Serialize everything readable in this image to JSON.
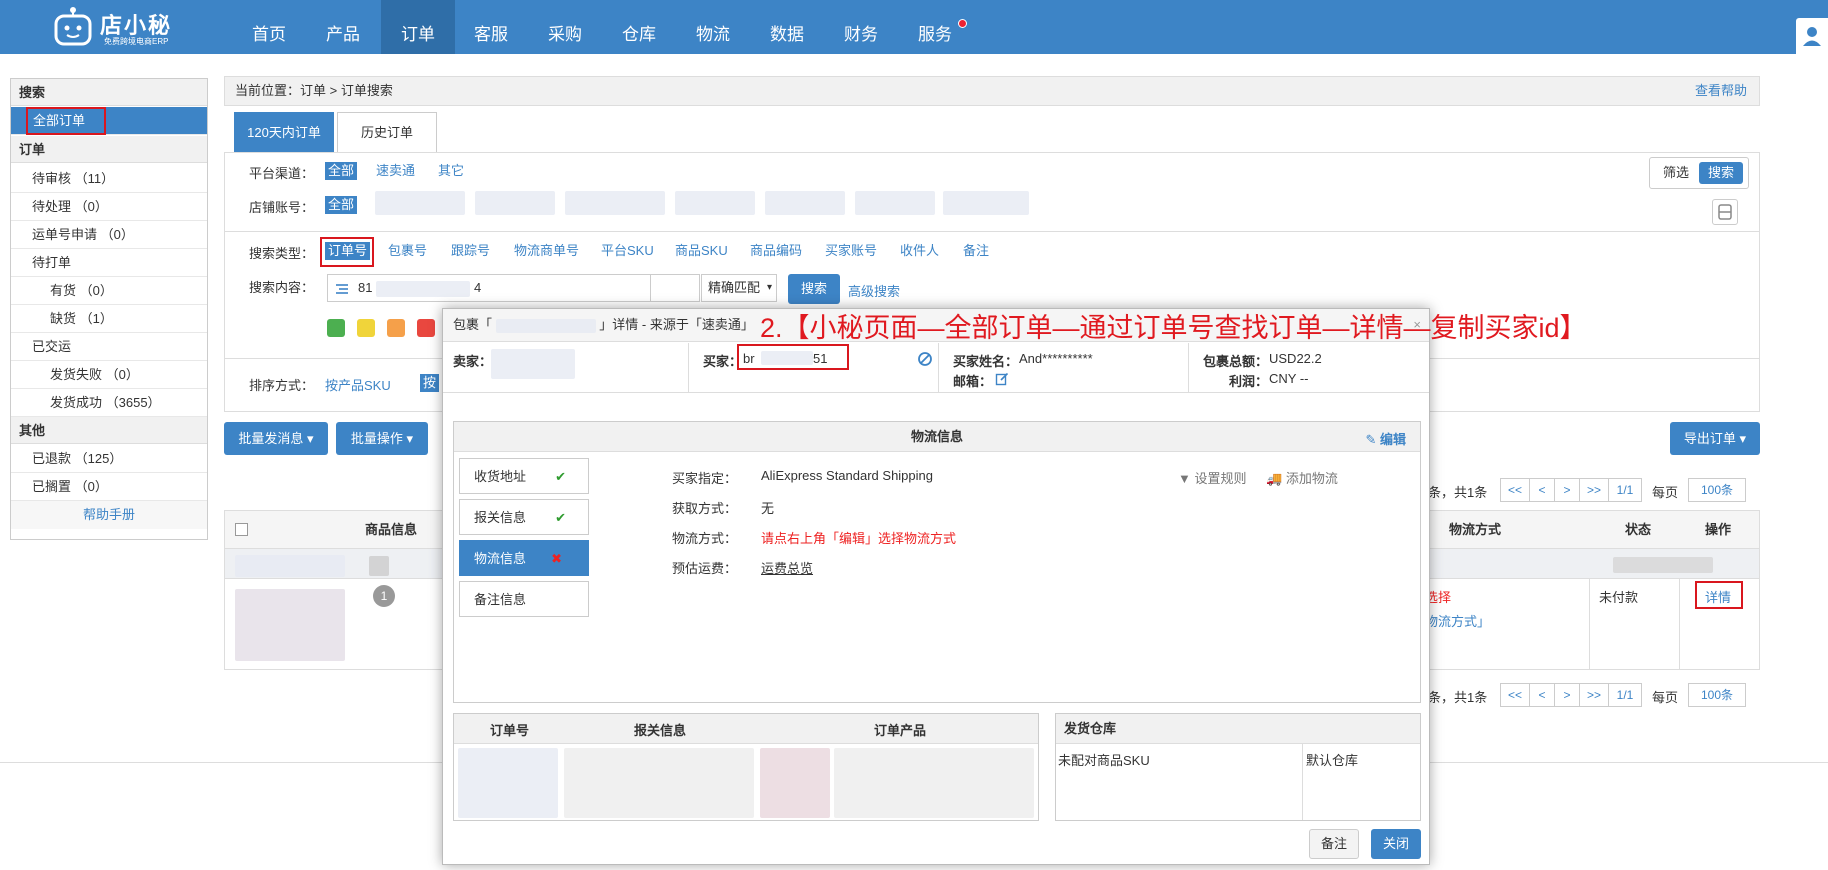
{
  "topnav": {
    "logo_name": "店小秘",
    "logo_sub": "免费跨境电商ERP",
    "items": [
      "首页",
      "产品",
      "订单",
      "客服",
      "采购",
      "仓库",
      "物流",
      "数据",
      "财务",
      "服务"
    ],
    "active": "订单"
  },
  "sidebar": {
    "search_header": "搜索",
    "all_orders": "全部订单",
    "orders_header": "订单",
    "items": [
      {
        "label": "待审核",
        "count": "（11）"
      },
      {
        "label": "待处理",
        "count": "（0）"
      },
      {
        "label": "运单号申请",
        "count": "（0）"
      },
      {
        "label": "待打单",
        "count": ""
      },
      {
        "label": "有货",
        "count": "（0）"
      },
      {
        "label": "缺货",
        "count": "（1）"
      },
      {
        "label": "已交运",
        "count": ""
      },
      {
        "label": "发货失败",
        "count": "（0）"
      },
      {
        "label": "发货成功",
        "count": "（3655）"
      }
    ],
    "other_header": "其他",
    "other_items": [
      {
        "label": "已退款",
        "count": "（125）"
      },
      {
        "label": "已搁置",
        "count": "（0）"
      }
    ],
    "help": "帮助手册"
  },
  "breadcrumb": {
    "text": "当前位置：订单 > 订单搜索",
    "help": "查看帮助"
  },
  "tabs": [
    "120天内订单",
    "历史订单"
  ],
  "filters": {
    "platform_label": "平台渠道：",
    "platform_opts": [
      "全部",
      "速卖通",
      "其它"
    ],
    "shop_label": "店铺账号：",
    "shop_all": "全部",
    "filter_btn": "筛选",
    "search_btn_top": "搜索",
    "search_type_label": "搜索类型：",
    "search_types": [
      "订单号",
      "包裹号",
      "跟踪号",
      "物流商单号",
      "平台SKU",
      "商品SKU",
      "商品编码",
      "买家账号",
      "收件人",
      "备注"
    ],
    "content_label": "搜索内容：",
    "content_value": "81",
    "content_value_tail": "4",
    "match_mode": "精确匹配",
    "search_btn": "搜索",
    "advanced": "高级搜索",
    "sort_label": "排序方式：",
    "sort_opt1": "按产品SKU",
    "sort_opt2": "按"
  },
  "toolbar": {
    "bulk_msg": "批量发消息 ▾",
    "bulk_op": "批量操作 ▾",
    "export": "导出订单 ▾"
  },
  "pager": {
    "summary": "条，共1条",
    "first": "<<",
    "prev": "<",
    "next": ">",
    "last": ">>",
    "page": "1/1",
    "per_label": "每页",
    "per_value": "100条"
  },
  "table": {
    "headers": {
      "product": "商品信息",
      "shipping": "物流方式",
      "status": "状态",
      "action": "操作"
    },
    "row": {
      "badge": "1",
      "ship1": "选择",
      "ship2": "物流方式」",
      "status": "未付款",
      "action": "详情"
    }
  },
  "modal": {
    "title_prefix": "包裹「",
    "title_suffix": "」详情 - 来源于「速卖通」",
    "seller_label": "卖家：",
    "buyer_label": "买家：",
    "buyer_prefix": "br",
    "buyer_suffix": "51",
    "buyer_name_label": "买家姓名：",
    "buyer_name": "And**********",
    "email_label": "邮箱：",
    "total_label": "包裹总额：",
    "total": "USD22.2",
    "profit_label": "利润：",
    "profit": "CNY --",
    "logistics_title": "物流信息",
    "edit": "编辑",
    "side_tabs": [
      {
        "label": "收货地址",
        "state": "ok"
      },
      {
        "label": "报关信息",
        "state": "ok"
      },
      {
        "label": "物流信息",
        "state": "bad"
      },
      {
        "label": "备注信息",
        "state": ""
      }
    ],
    "buyer_specified_label": "买家指定：",
    "buyer_specified": "AliExpress Standard Shipping",
    "fetch_label": "获取方式：",
    "fetch": "无",
    "method_label": "物流方式：",
    "method": "请点右上角「编辑」选择物流方式",
    "fee_label": "预估运费：",
    "fee": "运费总览",
    "set_rule": "设置规则",
    "add_logistics": "添加物流",
    "grid_headers": [
      "订单号",
      "报关信息",
      "订单产品"
    ],
    "warehouse_title": "发货仓库",
    "warehouse_sku": "未配对商品SKU",
    "warehouse_default": "默认仓库",
    "note_btn": "备注",
    "close_btn": "关闭"
  },
  "annotation": "2.【小秘页面—全部订单—通过订单号查找订单—详情—复制买家id】",
  "colors": {
    "primary": "#3d84c6",
    "annot_red": "#e0191f",
    "tags": [
      "#4caf50",
      "#f0d43a",
      "#f5a04a",
      "#e9473f"
    ]
  }
}
